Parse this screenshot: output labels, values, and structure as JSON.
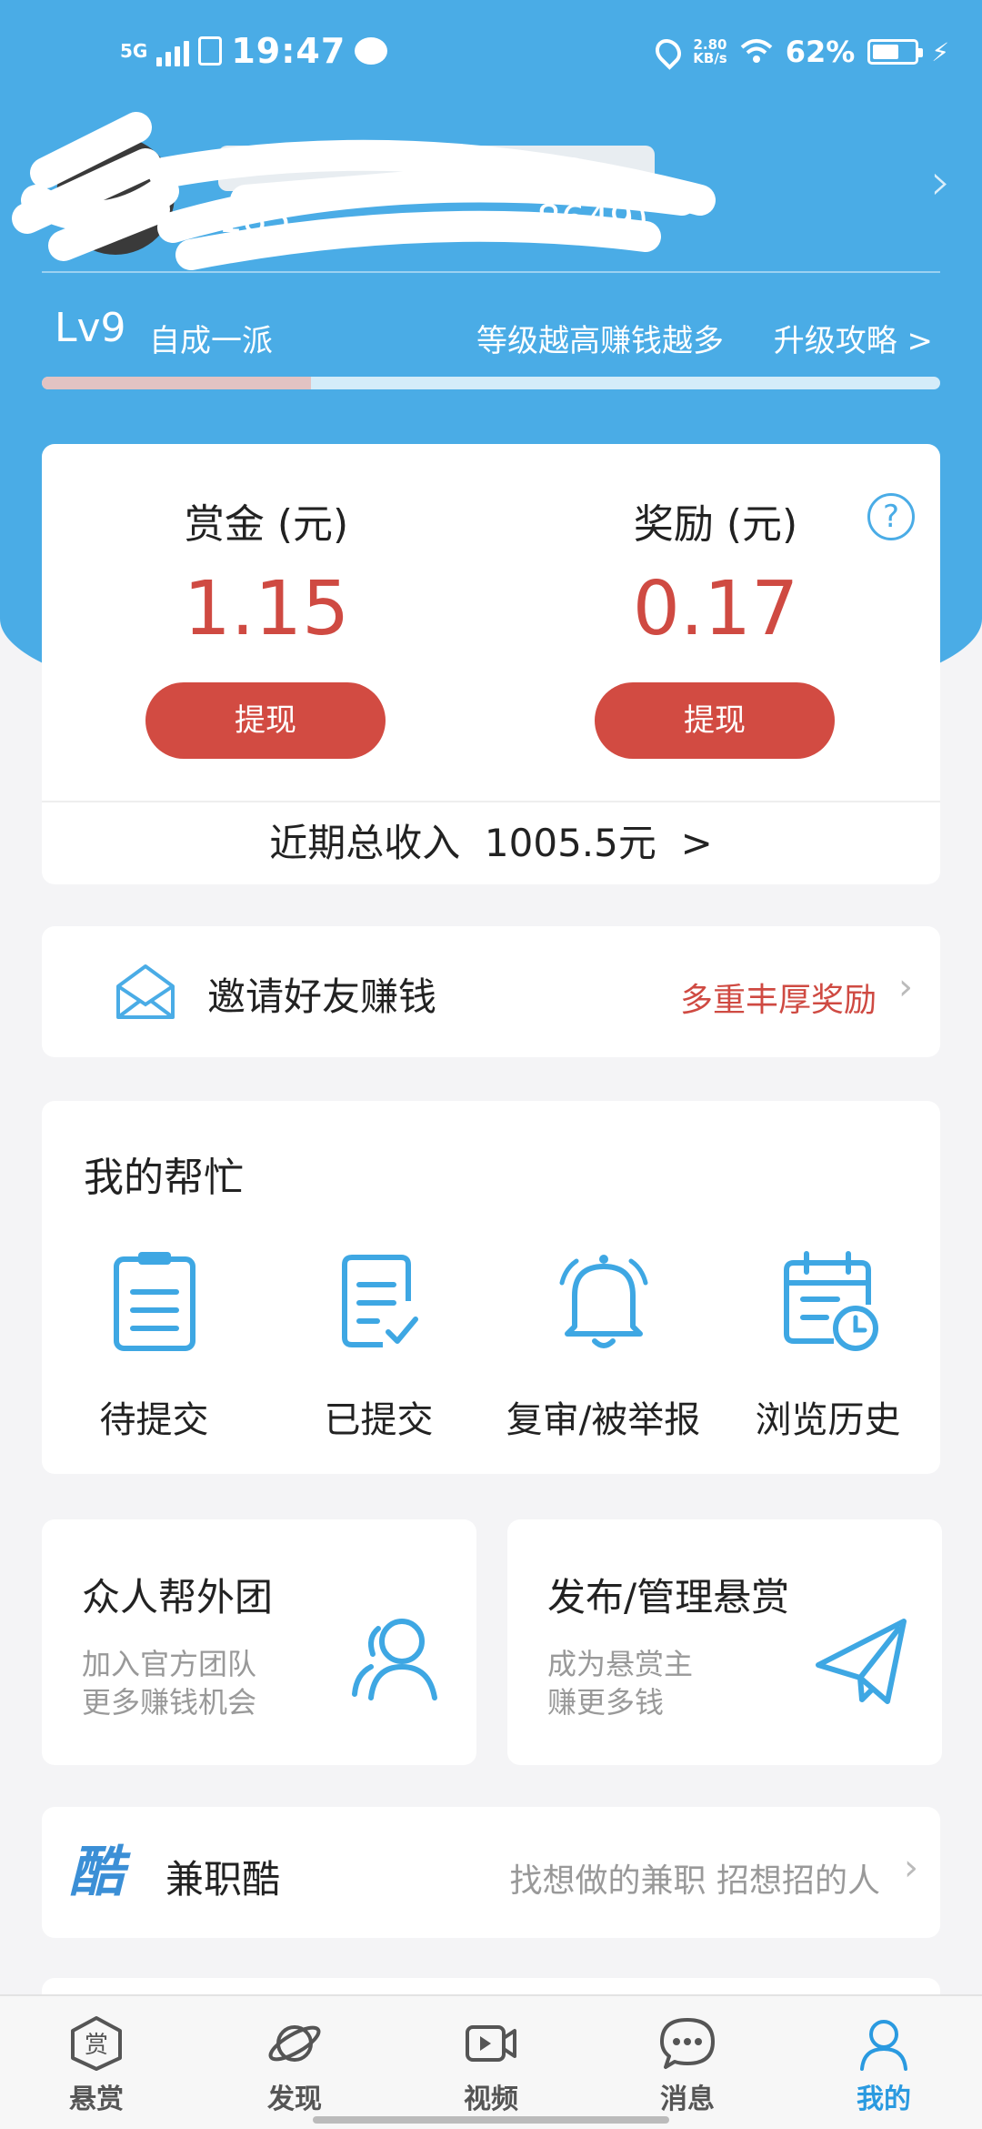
{
  "status_bar": {
    "network": "5G",
    "time": "19:47",
    "net_speed_value": "2.80",
    "net_speed_unit": "KB/s",
    "battery": "62%",
    "battery_level": 0.62
  },
  "profile": {
    "user_id_visible": "185",
    "user_id_suffix": "8649)"
  },
  "level": {
    "badge": "Lv9",
    "name": "自成一派",
    "hint": "等级越高赚钱越多",
    "link": "升级攻略 >",
    "progress": 0.3
  },
  "money": {
    "bounty_label": "赏金 (元)",
    "bounty_value": "1.15",
    "reward_label": "奖励 (元)",
    "reward_value": "0.17",
    "help_glyph": "?",
    "withdraw": "提现",
    "income_label": "近期总收入",
    "income_value": "1005.5元",
    "income_arrow": ">"
  },
  "invite": {
    "label": "邀请好友赚钱",
    "promo": "多重丰厚奖励"
  },
  "help": {
    "title": "我的帮忙",
    "items": [
      {
        "label": "待提交",
        "icon": "clipboard-icon"
      },
      {
        "label": "已提交",
        "icon": "document-check-icon"
      },
      {
        "label": "复审/被举报",
        "icon": "bell-icon"
      },
      {
        "label": "浏览历史",
        "icon": "calendar-clock-icon"
      }
    ]
  },
  "cards": {
    "team_title": "众人帮外团",
    "team_line1": "加入官方团队",
    "team_line2": "更多赚钱机会",
    "publish_title": "发布/管理悬赏",
    "publish_line1": "成为悬赏主",
    "publish_line2": "赚更多钱"
  },
  "jianzhiku": {
    "logo_text": "酷",
    "label": "兼职酷",
    "hint": "找想做的兼职 招想招的人"
  },
  "tabs": [
    {
      "label": "悬赏",
      "icon": "bounty-icon"
    },
    {
      "label": "发现",
      "icon": "planet-icon"
    },
    {
      "label": "视频",
      "icon": "video-icon"
    },
    {
      "label": "消息",
      "icon": "chat-icon"
    },
    {
      "label": "我的",
      "icon": "person-icon"
    }
  ],
  "colors": {
    "brand_blue": "#4aace6",
    "accent_red": "#cf4a42",
    "active_tab": "#2a9ae0"
  }
}
